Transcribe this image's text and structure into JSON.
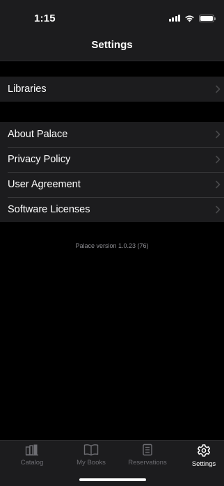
{
  "status_bar": {
    "time": "1:15",
    "signal_icon": "cellular-signal-icon",
    "wifi_icon": "wifi-icon",
    "battery_icon": "battery-icon",
    "battery_level": 1.0
  },
  "nav": {
    "title": "Settings"
  },
  "groups": [
    {
      "rows": [
        {
          "label": "Libraries",
          "icon": "chevron-right-icon"
        }
      ]
    },
    {
      "rows": [
        {
          "label": "About Palace",
          "icon": "chevron-right-icon"
        },
        {
          "label": "Privacy Policy",
          "icon": "chevron-right-icon"
        },
        {
          "label": "User Agreement",
          "icon": "chevron-right-icon"
        },
        {
          "label": "Software Licenses",
          "icon": "chevron-right-icon"
        }
      ]
    }
  ],
  "version_text": "Palace version 1.0.23 (76)",
  "tab_bar": {
    "active": "Settings",
    "tabs": [
      {
        "label": "Catalog",
        "icon": "catalog-icon"
      },
      {
        "label": "My Books",
        "icon": "book-icon"
      },
      {
        "label": "Reservations",
        "icon": "reservations-icon"
      },
      {
        "label": "Settings",
        "icon": "gear-icon"
      }
    ]
  },
  "colors": {
    "background": "#000000",
    "bar_background": "#1c1c1e",
    "text": "#ffffff",
    "secondary_text": "#8e8e93",
    "inactive_tab": "#6d6d72",
    "active_tab": "#ffffff"
  }
}
